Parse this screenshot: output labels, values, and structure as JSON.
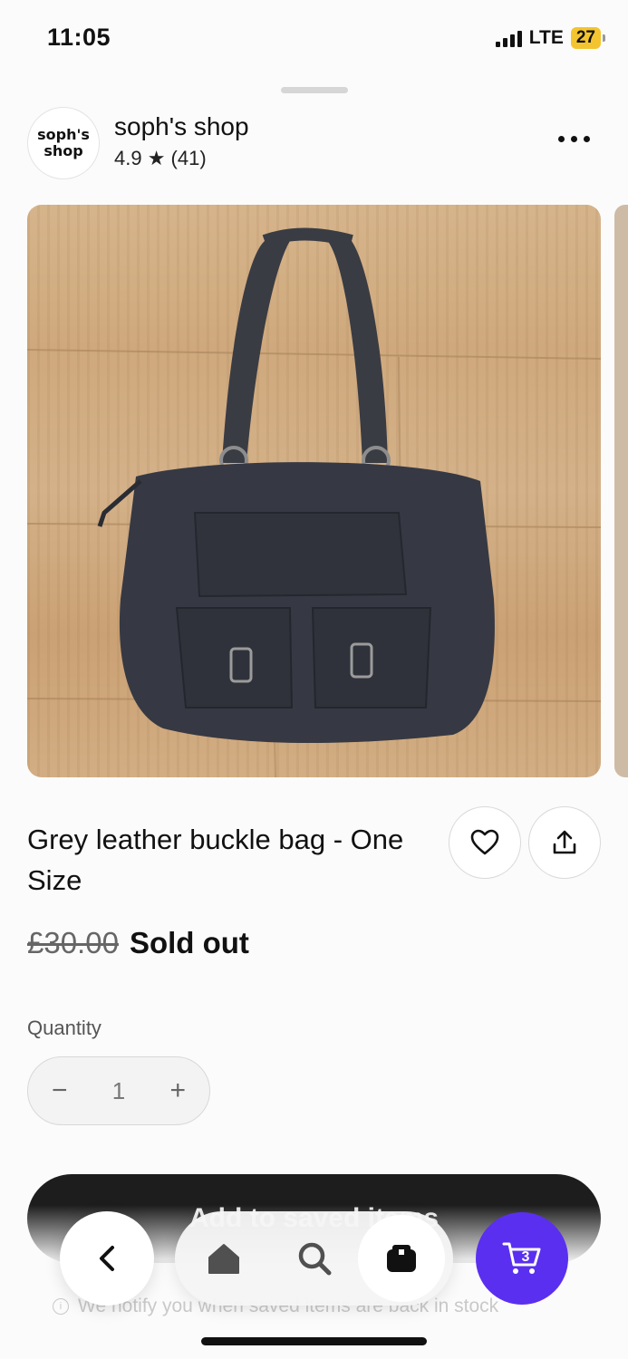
{
  "status_bar": {
    "time": "11:05",
    "network": "LTE",
    "battery": "27"
  },
  "shop": {
    "logo_line1": "soph's",
    "logo_line2": "shop",
    "name": "soph's shop",
    "rating": "4.9 ★ (41)"
  },
  "product": {
    "image_alt": "Grey leather buckle bag on wooden floor",
    "title": "Grey leather buckle bag - One Size",
    "old_price": "£30.00",
    "status": "Sold out"
  },
  "quantity": {
    "label": "Quantity",
    "minus": "−",
    "value": "1",
    "plus": "+"
  },
  "save_button_label": "Add to saved items",
  "notify_text": "We notify you when saved items are back in stock",
  "nav": {
    "cart_count": "3"
  },
  "colors": {
    "accent": "#5a2ff0",
    "button_dark": "#1d1d1d",
    "battery": "#f4c430"
  },
  "icons": [
    "more-icon",
    "heart-icon",
    "share-icon",
    "info-icon",
    "back-chevron-icon",
    "home-icon",
    "search-icon",
    "orders-icon",
    "cart-icon"
  ]
}
